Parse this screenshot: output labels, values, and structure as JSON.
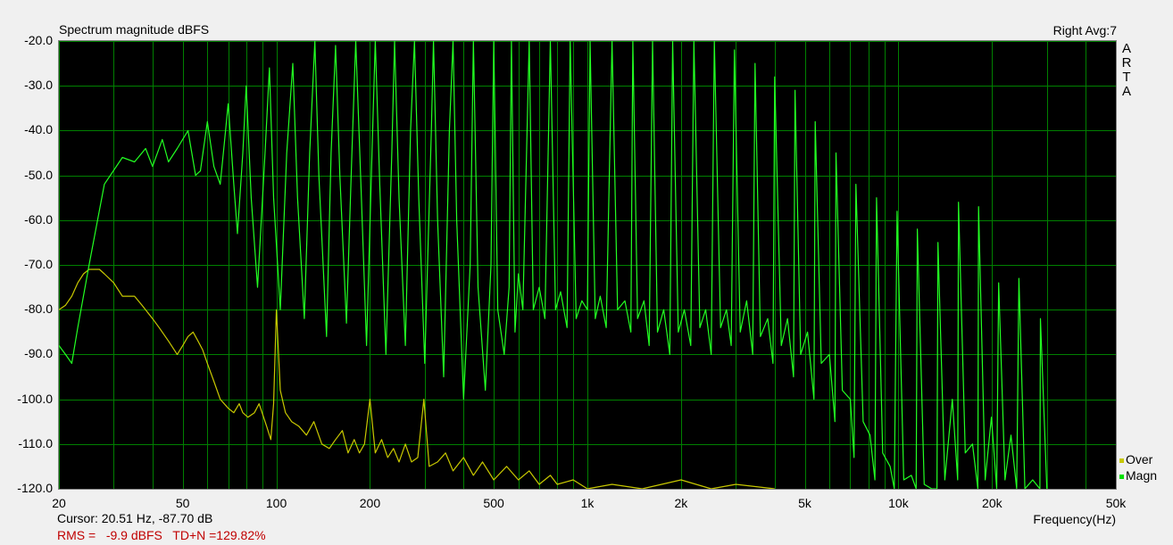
{
  "window": {
    "title": "Spectrum magnitude dBFS",
    "channel_info": "Right  Avg:7",
    "brand_letters": [
      "A",
      "R",
      "T",
      "A"
    ]
  },
  "status": {
    "cursor": "Cursor: 20.51 Hz, -87.70 dB",
    "rms": "RMS =   -9.9 dBFS   TD+N =129.82%"
  },
  "legend": [
    {
      "label": "Over",
      "color": "#c8c800"
    },
    {
      "label": "Magn",
      "color": "#00e000"
    }
  ],
  "colors": {
    "background": "#000000",
    "grid": "#008000",
    "magn": "#22ff22",
    "over": "#c8c800"
  },
  "chart_data": {
    "type": "line",
    "title": "Spectrum magnitude dBFS",
    "xlabel": "Frequency(Hz)",
    "ylabel": "",
    "x_scale": "log",
    "xlim": [
      20,
      50000
    ],
    "ylim": [
      -120,
      -20
    ],
    "x_ticks": [
      {
        "value": 20,
        "label": "20"
      },
      {
        "value": 50,
        "label": "50"
      },
      {
        "value": 100,
        "label": "100"
      },
      {
        "value": 200,
        "label": "200"
      },
      {
        "value": 500,
        "label": "500"
      },
      {
        "value": 1000,
        "label": "1k"
      },
      {
        "value": 2000,
        "label": "2k"
      },
      {
        "value": 5000,
        "label": "5k"
      },
      {
        "value": 10000,
        "label": "10k"
      },
      {
        "value": 20000,
        "label": "20k"
      },
      {
        "value": 50000,
        "label": "50k"
      }
    ],
    "y_ticks": [
      {
        "value": -20,
        "label": "-20.0"
      },
      {
        "value": -30,
        "label": "-30.0"
      },
      {
        "value": -40,
        "label": "-40.0"
      },
      {
        "value": -50,
        "label": "-50.0"
      },
      {
        "value": -60,
        "label": "-60.0"
      },
      {
        "value": -70,
        "label": "-70.0"
      },
      {
        "value": -80,
        "label": "-80.0"
      },
      {
        "value": -90,
        "label": "-90.0"
      },
      {
        "value": -100,
        "label": "-100.0"
      },
      {
        "value": -110,
        "label": "-110.0"
      },
      {
        "value": -120,
        "label": "-120.0"
      }
    ],
    "grid": true,
    "legend_position": "bottom-right",
    "series": [
      {
        "name": "Magn",
        "color": "#22ff22",
        "points": [
          [
            20,
            -88
          ],
          [
            21,
            -90
          ],
          [
            22,
            -92
          ],
          [
            23,
            -84
          ],
          [
            25,
            -70
          ],
          [
            28,
            -52
          ],
          [
            32,
            -46
          ],
          [
            35,
            -47
          ],
          [
            38,
            -44
          ],
          [
            40,
            -48
          ],
          [
            43,
            -42
          ],
          [
            45,
            -47
          ],
          [
            48,
            -44
          ],
          [
            52,
            -40
          ],
          [
            55,
            -50
          ],
          [
            57,
            -49
          ],
          [
            60,
            -38
          ],
          [
            63,
            -48
          ],
          [
            66,
            -52
          ],
          [
            68,
            -43
          ],
          [
            70,
            -34
          ],
          [
            73,
            -52
          ],
          [
            75,
            -63
          ],
          [
            78,
            -45
          ],
          [
            80,
            -30
          ],
          [
            83,
            -55
          ],
          [
            87,
            -75
          ],
          [
            92,
            -45
          ],
          [
            95,
            -26
          ],
          [
            98,
            -55
          ],
          [
            103,
            -80
          ],
          [
            108,
            -45
          ],
          [
            113,
            -25
          ],
          [
            117,
            -55
          ],
          [
            123,
            -82
          ],
          [
            128,
            -45
          ],
          [
            133,
            -20
          ],
          [
            137,
            -50
          ],
          [
            145,
            -86
          ],
          [
            150,
            -45
          ],
          [
            155,
            -21
          ],
          [
            160,
            -50
          ],
          [
            168,
            -83
          ],
          [
            175,
            -45
          ],
          [
            180,
            -20
          ],
          [
            187,
            -52
          ],
          [
            195,
            -88
          ],
          [
            203,
            -45
          ],
          [
            208,
            -20
          ],
          [
            215,
            -52
          ],
          [
            225,
            -90
          ],
          [
            235,
            -45
          ],
          [
            240,
            -19
          ],
          [
            248,
            -55
          ],
          [
            260,
            -88
          ],
          [
            270,
            -40
          ],
          [
            278,
            -18
          ],
          [
            287,
            -55
          ],
          [
            300,
            -92
          ],
          [
            315,
            -40
          ],
          [
            320,
            -18
          ],
          [
            330,
            -60
          ],
          [
            345,
            -95
          ],
          [
            360,
            -40
          ],
          [
            370,
            -18
          ],
          [
            380,
            -60
          ],
          [
            400,
            -100
          ],
          [
            420,
            -70
          ],
          [
            430,
            -18
          ],
          [
            445,
            -75
          ],
          [
            470,
            -98
          ],
          [
            490,
            -70
          ],
          [
            500,
            -18
          ],
          [
            515,
            -80
          ],
          [
            540,
            -90
          ],
          [
            560,
            -75
          ],
          [
            570,
            -18
          ],
          [
            585,
            -85
          ],
          [
            600,
            -72
          ],
          [
            620,
            -80
          ],
          [
            650,
            -18
          ],
          [
            670,
            -80
          ],
          [
            700,
            -75
          ],
          [
            730,
            -82
          ],
          [
            760,
            -17
          ],
          [
            790,
            -80
          ],
          [
            820,
            -76
          ],
          [
            860,
            -84
          ],
          [
            880,
            -17
          ],
          [
            920,
            -82
          ],
          [
            960,
            -78
          ],
          [
            1000,
            -80
          ],
          [
            1020,
            -17
          ],
          [
            1060,
            -82
          ],
          [
            1100,
            -77
          ],
          [
            1150,
            -84
          ],
          [
            1200,
            -18
          ],
          [
            1250,
            -80
          ],
          [
            1320,
            -78
          ],
          [
            1380,
            -85
          ],
          [
            1400,
            -18
          ],
          [
            1450,
            -82
          ],
          [
            1520,
            -78
          ],
          [
            1580,
            -88
          ],
          [
            1620,
            -19
          ],
          [
            1680,
            -85
          ],
          [
            1760,
            -80
          ],
          [
            1840,
            -90
          ],
          [
            1880,
            -19
          ],
          [
            1960,
            -85
          ],
          [
            2050,
            -80
          ],
          [
            2150,
            -88
          ],
          [
            2200,
            -20
          ],
          [
            2300,
            -84
          ],
          [
            2400,
            -80
          ],
          [
            2500,
            -90
          ],
          [
            2560,
            -20
          ],
          [
            2680,
            -84
          ],
          [
            2800,
            -80
          ],
          [
            2900,
            -88
          ],
          [
            2970,
            -22
          ],
          [
            3100,
            -85
          ],
          [
            3250,
            -78
          ],
          [
            3400,
            -90
          ],
          [
            3460,
            -25
          ],
          [
            3600,
            -86
          ],
          [
            3800,
            -82
          ],
          [
            3950,
            -92
          ],
          [
            4000,
            -28
          ],
          [
            4200,
            -88
          ],
          [
            4400,
            -82
          ],
          [
            4600,
            -95
          ],
          [
            4650,
            -31
          ],
          [
            4850,
            -90
          ],
          [
            5100,
            -85
          ],
          [
            5350,
            -100
          ],
          [
            5400,
            -38
          ],
          [
            5650,
            -92
          ],
          [
            6000,
            -90
          ],
          [
            6250,
            -105
          ],
          [
            6300,
            -45
          ],
          [
            6600,
            -98
          ],
          [
            7000,
            -100
          ],
          [
            7200,
            -113
          ],
          [
            7300,
            -52
          ],
          [
            7700,
            -105
          ],
          [
            8100,
            -108
          ],
          [
            8400,
            -118
          ],
          [
            8500,
            -55
          ],
          [
            8900,
            -112
          ],
          [
            9400,
            -115
          ],
          [
            9700,
            -120
          ],
          [
            9900,
            -58
          ],
          [
            10400,
            -118
          ],
          [
            11000,
            -117
          ],
          [
            11400,
            -120
          ],
          [
            11500,
            -62
          ],
          [
            12100,
            -119
          ],
          [
            12800,
            -120
          ],
          [
            13300,
            -120
          ],
          [
            13400,
            -65
          ],
          [
            14100,
            -118
          ],
          [
            14900,
            -100
          ],
          [
            15500,
            -118
          ],
          [
            15600,
            -56
          ],
          [
            16400,
            -112
          ],
          [
            17300,
            -110
          ],
          [
            18000,
            -120
          ],
          [
            18100,
            -57
          ],
          [
            19000,
            -118
          ],
          [
            19900,
            -104
          ],
          [
            20700,
            -120
          ],
          [
            21000,
            -74
          ],
          [
            22000,
            -118
          ],
          [
            23000,
            -108
          ],
          [
            24000,
            -120
          ],
          [
            24400,
            -73
          ],
          [
            25500,
            -120
          ],
          [
            27000,
            -118
          ],
          [
            28500,
            -120
          ],
          [
            28600,
            -82
          ],
          [
            30000,
            -120
          ]
        ]
      },
      {
        "name": "Over",
        "color": "#c8c800",
        "points": [
          [
            20,
            -80
          ],
          [
            21,
            -79
          ],
          [
            22,
            -77
          ],
          [
            23,
            -74
          ],
          [
            24,
            -72
          ],
          [
            25,
            -71
          ],
          [
            27,
            -71
          ],
          [
            28,
            -72
          ],
          [
            30,
            -74
          ],
          [
            32,
            -77
          ],
          [
            35,
            -77
          ],
          [
            37,
            -79
          ],
          [
            40,
            -82
          ],
          [
            42,
            -84
          ],
          [
            45,
            -87
          ],
          [
            47,
            -89
          ],
          [
            48,
            -90
          ],
          [
            50,
            -88
          ],
          [
            52,
            -86
          ],
          [
            54,
            -85
          ],
          [
            56,
            -87
          ],
          [
            58,
            -89
          ],
          [
            60,
            -92
          ],
          [
            63,
            -96
          ],
          [
            66,
            -100
          ],
          [
            70,
            -102
          ],
          [
            73,
            -103
          ],
          [
            76,
            -101
          ],
          [
            78,
            -103
          ],
          [
            81,
            -104
          ],
          [
            85,
            -103
          ],
          [
            88,
            -101
          ],
          [
            90,
            -103
          ],
          [
            93,
            -106
          ],
          [
            96,
            -109
          ],
          [
            98,
            -101
          ],
          [
            100,
            -80
          ],
          [
            103,
            -98
          ],
          [
            107,
            -103
          ],
          [
            112,
            -105
          ],
          [
            118,
            -106
          ],
          [
            125,
            -108
          ],
          [
            132,
            -105
          ],
          [
            140,
            -110
          ],
          [
            148,
            -111
          ],
          [
            155,
            -109
          ],
          [
            163,
            -107
          ],
          [
            170,
            -112
          ],
          [
            178,
            -109
          ],
          [
            185,
            -112
          ],
          [
            192,
            -110
          ],
          [
            200,
            -100
          ],
          [
            208,
            -112
          ],
          [
            218,
            -109
          ],
          [
            228,
            -113
          ],
          [
            238,
            -111
          ],
          [
            248,
            -114
          ],
          [
            260,
            -110
          ],
          [
            272,
            -114
          ],
          [
            285,
            -113
          ],
          [
            298,
            -100
          ],
          [
            310,
            -115
          ],
          [
            330,
            -114
          ],
          [
            350,
            -112
          ],
          [
            370,
            -116
          ],
          [
            400,
            -113
          ],
          [
            430,
            -117
          ],
          [
            460,
            -114
          ],
          [
            500,
            -118
          ],
          [
            550,
            -115
          ],
          [
            600,
            -118
          ],
          [
            650,
            -116
          ],
          [
            700,
            -119
          ],
          [
            760,
            -117
          ],
          [
            800,
            -119
          ],
          [
            900,
            -118
          ],
          [
            1000,
            -120
          ],
          [
            1200,
            -119
          ],
          [
            1500,
            -120
          ],
          [
            2000,
            -118
          ],
          [
            2500,
            -120
          ],
          [
            3000,
            -119
          ],
          [
            4000,
            -120
          ]
        ]
      }
    ]
  }
}
